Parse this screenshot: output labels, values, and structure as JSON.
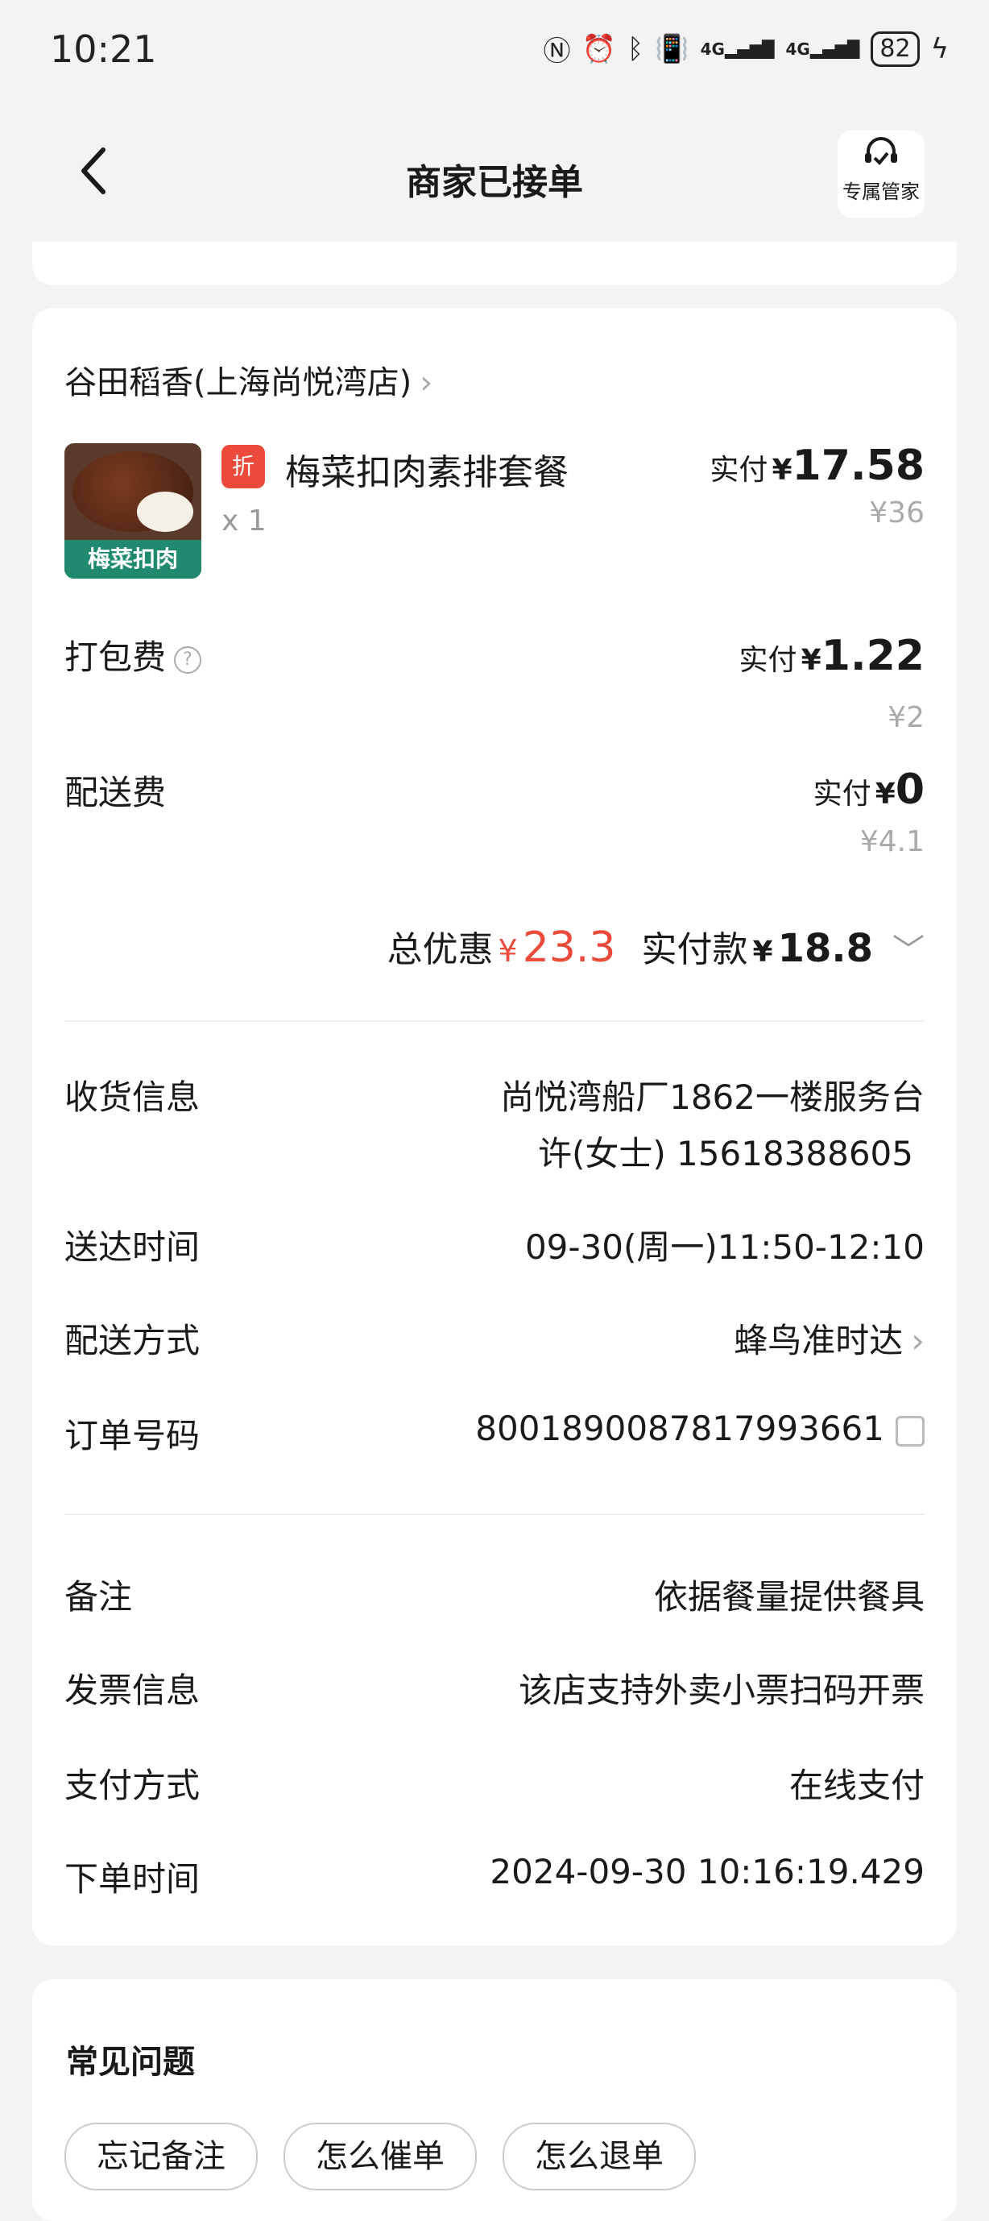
{
  "status_bar": {
    "time": "10:21",
    "battery": "82",
    "net1": "4G",
    "net2": "4G"
  },
  "header": {
    "title": "商家已接单",
    "steward_label": "专属管家"
  },
  "store": {
    "name": "谷田稻香(上海尚悦湾店)"
  },
  "item": {
    "badge": "折",
    "name": "梅菜扣肉素排套餐",
    "thumb_label": "梅菜扣肉",
    "qty": "x 1",
    "paid_label": "实付",
    "paid_yen": "¥",
    "paid_value": "17.58",
    "original": "¥36"
  },
  "packing_fee": {
    "label": "打包费",
    "paid_label": "实付",
    "paid_yen": "¥",
    "paid_value": "1.22",
    "original": "¥2"
  },
  "delivery_fee": {
    "label": "配送费",
    "paid_label": "实付",
    "paid_yen": "¥",
    "paid_value": "0",
    "original": "¥4.1"
  },
  "totals": {
    "discount_label": "总优惠",
    "discount_yen": "¥",
    "discount_value": "23.3",
    "paid_label": "实付款",
    "paid_yen": "¥",
    "paid_value": "18.8"
  },
  "order_info": {
    "address_label": "收货信息",
    "address_line1": "尚悦湾船厂1862一楼服务台",
    "address_line2": "许(女士) 15618388605",
    "arrival_label": "送达时间",
    "arrival_value": "09-30(周一)11:50-12:10",
    "delivery_method_label": "配送方式",
    "delivery_method_value": "蜂鸟准时达",
    "order_no_label": "订单号码",
    "order_no_value": "8001890087817993661"
  },
  "extra_info": {
    "note_label": "备注",
    "note_value": "依据餐量提供餐具",
    "invoice_label": "发票信息",
    "invoice_value": "该店支持外卖小票扫码开票",
    "payment_label": "支付方式",
    "payment_value": "在线支付",
    "order_time_label": "下单时间",
    "order_time_value": "2024-09-30 10:16:19.429"
  },
  "faq": {
    "title": "常见问题",
    "chips": [
      "忘记备注",
      "怎么催单",
      "怎么退单"
    ]
  },
  "colors": {
    "accent_red": "#ec4b3b",
    "background": "#f3f3f3",
    "card": "#ffffff"
  }
}
